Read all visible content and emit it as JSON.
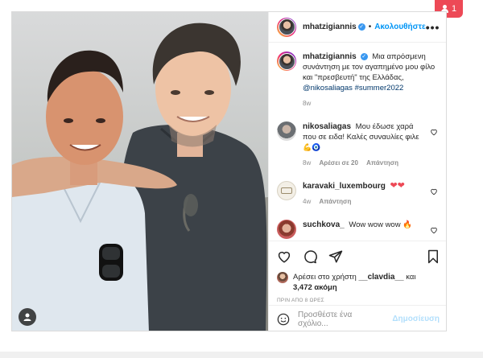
{
  "notification": {
    "count": "1"
  },
  "post": {
    "author": "mhatzigiannis",
    "follow_label": "Ακολουθήστε",
    "more_label": "•••",
    "caption": {
      "username": "mhatzigiannis",
      "text": "Μια απρόσμενη συνάντηση με τον αγαπημένο μου φίλο και \"πρεσβευτή\" της Ελλάδας,",
      "mention": "@nikosaliagas",
      "hashtag": "#summer2022",
      "age": "8w"
    },
    "comments": [
      {
        "username": "nikosaliagas",
        "text": "Μου έδωσε χαρά που σε ειδα! Καλές συναυλίες φιλε",
        "emoji": "💪🧿",
        "age": "8w",
        "likes": "Αρέσει σε 20",
        "reply": "Απάντηση"
      },
      {
        "username": "karavaki_luxembourg",
        "text": "",
        "emoji": "❤❤",
        "age": "4w",
        "reply": "Απάντηση"
      },
      {
        "username": "suchkova_",
        "text": "Wow wow wow",
        "emoji": "🔥"
      }
    ],
    "likes_line": {
      "prefix": "Αρέσει στο χρήστη",
      "user": "__clavdia__",
      "suffix": "και",
      "count": "3,472 ακόμη"
    },
    "timestamp": "ΠΡΙΝ ΑΠΟ 8 ΩΡΕΣ",
    "comment_placeholder": "Προσθέστε ένα σχόλιο...",
    "post_label": "Δημοσίευση"
  },
  "colors": {
    "accent": "#0095f6",
    "like_red": "#ed4956",
    "notif_red": "#ed4956",
    "muted": "#8e8e8e"
  },
  "icons": [
    "heart-icon",
    "comment-icon",
    "share-icon",
    "bookmark-icon",
    "emoji-icon",
    "user-tag-icon",
    "more-icon",
    "verified-badge"
  ]
}
